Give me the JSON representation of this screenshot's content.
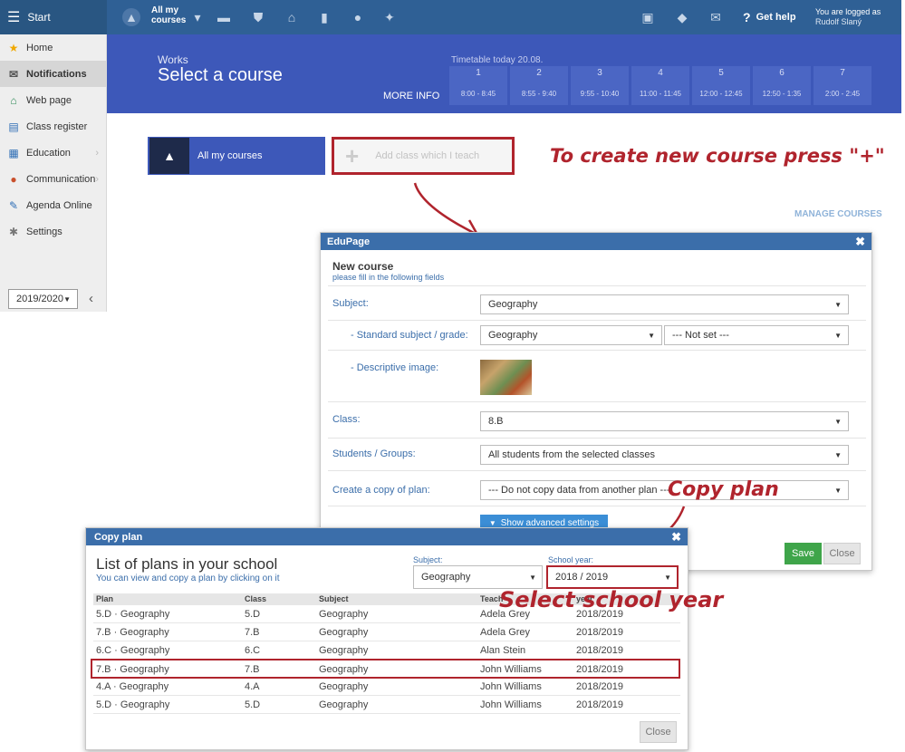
{
  "topbar": {
    "start_label": "Start",
    "all_my_courses": "All my courses",
    "get_help": "Get help",
    "logged_label": "You are logged as",
    "user_name": "Rudolf Slaný"
  },
  "sidebar": {
    "items": [
      {
        "label": "Home",
        "icon": "star-icon"
      },
      {
        "label": "Notifications",
        "icon": "envelope-icon"
      },
      {
        "label": "Web page",
        "icon": "home-icon"
      },
      {
        "label": "Class register",
        "icon": "book-icon"
      },
      {
        "label": "Education",
        "icon": "school-icon"
      },
      {
        "label": "Communication",
        "icon": "chat-icon"
      },
      {
        "label": "Agenda Online",
        "icon": "pencil-icon"
      },
      {
        "label": "Settings",
        "icon": "gear-icon"
      }
    ],
    "year": "2019/2020"
  },
  "header": {
    "section": "Works",
    "title": "Select a course",
    "more_info": "MORE INFO",
    "timetable_label": "Timetable today 20.08.",
    "periods": [
      {
        "num": "1",
        "time": "8:00 - 8:45"
      },
      {
        "num": "2",
        "time": "8:55 - 9:40"
      },
      {
        "num": "3",
        "time": "9:55 - 10:40"
      },
      {
        "num": "4",
        "time": "11:00 - 11:45"
      },
      {
        "num": "5",
        "time": "12:00 - 12:45"
      },
      {
        "num": "6",
        "time": "12:50 - 1:35"
      },
      {
        "num": "7",
        "time": "2:00 - 2:45"
      }
    ]
  },
  "courses": {
    "all_my_courses": "All my courses",
    "add_class": "Add class which I teach",
    "manage": "MANAGE COURSES"
  },
  "new_course": {
    "window_title": "EduPage",
    "heading": "New course",
    "subheading": "please fill in the following fields",
    "subject_label": "Subject:",
    "subject_value": "Geography",
    "standard_label": "- Standard subject / grade:",
    "standard_value": "Geography",
    "grade_value": "--- Not set ---",
    "image_label": "- Descriptive image:",
    "class_label": "Class:",
    "class_value": "8.B",
    "students_label": "Students / Groups:",
    "students_value": "All students from the selected classes",
    "copy_label": "Create a copy of plan:",
    "copy_value": "--- Do not copy data from another plan ---",
    "advanced": "Show advanced settings",
    "save": "Save",
    "close": "Close"
  },
  "copy_plan": {
    "window_title": "Copy plan",
    "title": "List of plans in your school",
    "subtitle": "You can view and copy a plan by clicking on it",
    "subject_label": "Subject:",
    "subject_value": "Geography",
    "year_label": "School year:",
    "year_value": "2018 / 2019",
    "columns": {
      "plan": "Plan",
      "class": "Class",
      "subject": "Subject",
      "teacher": "Teach",
      "year": "year"
    },
    "rows": [
      {
        "plan": "5.D · Geography",
        "class": "5.D",
        "subject": "Geography",
        "teacher": "Adela Grey",
        "year": "2018/2019"
      },
      {
        "plan": "7.B · Geography",
        "class": "7.B",
        "subject": "Geography",
        "teacher": "Adela Grey",
        "year": "2018/2019"
      },
      {
        "plan": "6.C · Geography",
        "class": "6.C",
        "subject": "Geography",
        "teacher": "Alan Stein",
        "year": "2018/2019"
      },
      {
        "plan": "7.B · Geography",
        "class": "7.B",
        "subject": "Geography",
        "teacher": "John Williams",
        "year": "2018/2019"
      },
      {
        "plan": "4.A · Geography",
        "class": "4.A",
        "subject": "Geography",
        "teacher": "John Williams",
        "year": "2018/2019"
      },
      {
        "plan": "5.D · Geography",
        "class": "5.D",
        "subject": "Geography",
        "teacher": "John Williams",
        "year": "2018/2019"
      }
    ],
    "close": "Close"
  },
  "annotations": {
    "create": "To create new course press \"+\"",
    "copy": "Copy plan",
    "select_year": "Select school year"
  },
  "colors": {
    "topbar": "#2f6095",
    "header": "#3d58b9",
    "annotation": "#b0242d",
    "dialog_bar": "#3b6eaa"
  }
}
